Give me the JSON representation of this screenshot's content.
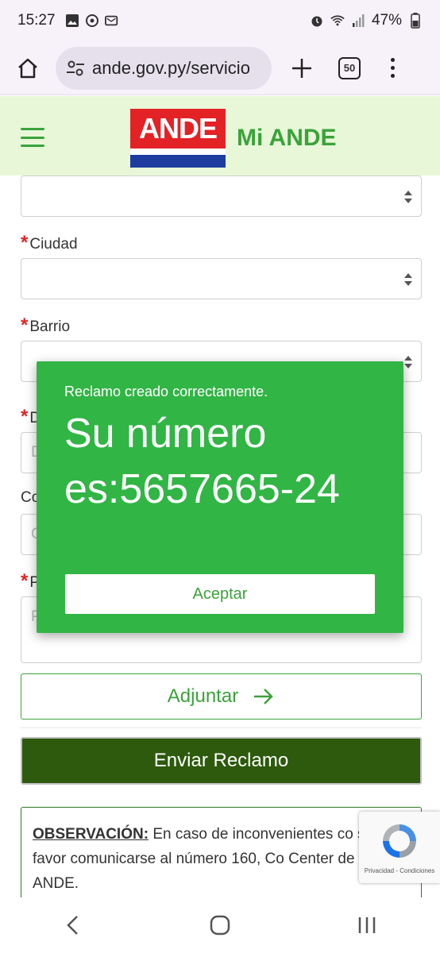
{
  "status_bar": {
    "time": "15:27",
    "battery": "47%"
  },
  "browser": {
    "url": "ande.gov.py/servicio",
    "tab_count": "50"
  },
  "header": {
    "logo_text": "ANDE",
    "title": "Mi ANDE"
  },
  "form": {
    "ciudad_label": "Ciudad",
    "barrio_label": "Barrio",
    "partial_label_d": "D",
    "partial_label_co": "Co",
    "partial_label_p": "P",
    "partial_placeholder_d": "D",
    "partial_placeholder_c": "C",
    "partial_placeholder_p": "P",
    "adjuntar_label": "Adjuntar",
    "enviar_label": "Enviar Reclamo"
  },
  "observacion": {
    "title": "OBSERVACIÓN:",
    "text": " En caso de inconvenientes co servicio favor comunicarse al número 160, Co Center de la ANDE."
  },
  "recaptcha": {
    "terms": "Privacidad - Condiciones"
  },
  "modal": {
    "message": "Reclamo creado correctamente.",
    "number_line1": "Su número",
    "number_line2": "es:5657665-24",
    "button_label": "Aceptar"
  },
  "colors": {
    "green": "#31b545",
    "dark_green": "#2d5a0d",
    "red": "#e32226",
    "blue": "#1d3c9f"
  }
}
